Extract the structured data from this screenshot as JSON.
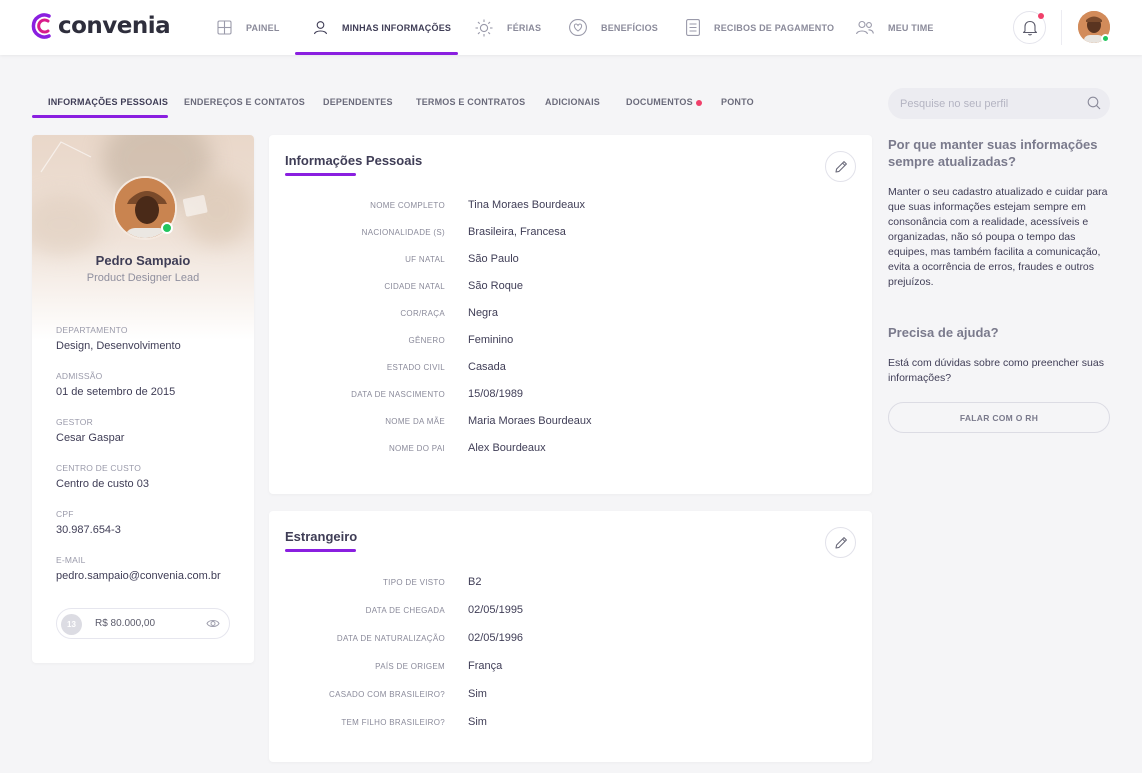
{
  "brand": {
    "name": "convenia",
    "accent": "#8a1fe0"
  },
  "nav": {
    "items": [
      {
        "label": "PAINEL",
        "icon": "grid-icon"
      },
      {
        "label": "MINHAS INFORMAÇÕES",
        "icon": "user-icon"
      },
      {
        "label": "FÉRIAS",
        "icon": "sun-icon"
      },
      {
        "label": "BENEFÍCIOS",
        "icon": "heart-icon"
      },
      {
        "label": "RECIBOS DE PAGAMENTO",
        "icon": "receipt-icon"
      },
      {
        "label": "MEU TIME",
        "icon": "team-icon"
      }
    ],
    "active": "MINHAS INFORMAÇÕES"
  },
  "subtabs": [
    {
      "label": "INFORMAÇÕES PESSOAIS"
    },
    {
      "label": "ENDEREÇOS E CONTATOS"
    },
    {
      "label": "DEPENDENTES"
    },
    {
      "label": "TERMOS E CONTRATOS"
    },
    {
      "label": "ADICIONAIS"
    },
    {
      "label": "DOCUMENTOS"
    },
    {
      "label": "PONTO"
    }
  ],
  "search": {
    "placeholder": "Pesquise no seu perfil"
  },
  "profile": {
    "name": "Pedro Sampaio",
    "role": "Product Designer Lead",
    "fields": [
      {
        "label": "DEPARTAMENTO",
        "value": "Design, Desenvolvimento"
      },
      {
        "label": "ADMISSÃO",
        "value": "01 de setembro de 2015"
      },
      {
        "label": "GESTOR",
        "value": "Cesar Gaspar"
      },
      {
        "label": "CENTRO DE CUSTO",
        "value": "Centro de custo 03"
      },
      {
        "label": "CPF",
        "value": "30.987.654-3"
      },
      {
        "label": "E-MAIL",
        "value": "pedro.sampaio@convenia.com.br"
      }
    ],
    "salary": {
      "coin": "13",
      "value": "R$ 80.000,00"
    }
  },
  "personal": {
    "title": "Informações Pessoais",
    "rows": [
      {
        "label": "NOME COMPLETO",
        "value": "Tina Moraes Bourdeaux"
      },
      {
        "label": "NACIONALIDADE (S)",
        "value": "Brasileira, Francesa"
      },
      {
        "label": "UF NATAL",
        "value": "São Paulo"
      },
      {
        "label": "CIDADE NATAL",
        "value": "São Roque"
      },
      {
        "label": "COR/RAÇA",
        "value": "Negra"
      },
      {
        "label": "GÊNERO",
        "value": "Feminino"
      },
      {
        "label": "ESTADO CIVIL",
        "value": "Casada"
      },
      {
        "label": "DATA DE NASCIMENTO",
        "value": "15/08/1989"
      },
      {
        "label": "NOME DA MÃE",
        "value": "Maria Moraes Bourdeaux"
      },
      {
        "label": "NOME DO PAI",
        "value": "Alex Bourdeaux"
      }
    ]
  },
  "foreign": {
    "title": "Estrangeiro",
    "rows": [
      {
        "label": "TIPO DE VISTO",
        "value": "B2"
      },
      {
        "label": "DATA DE CHEGADA",
        "value": "02/05/1995"
      },
      {
        "label": "DATA DE NATURALIZAÇÃO",
        "value": "02/05/1996"
      },
      {
        "label": "PAÍS DE ORIGEM",
        "value": "França"
      },
      {
        "label": "CASADO COM BRASILEIRO?",
        "value": "Sim"
      },
      {
        "label": "TEM FILHO BRASILEIRO?",
        "value": "Sim"
      }
    ]
  },
  "help": {
    "why_title": "Por que manter suas informações sempre atualizadas?",
    "why_text": "Manter o seu cadastro atualizado e cuidar para que suas informações estejam sempre em consonância com a realidade, acessíveis e organizadas, não só poupa o tempo das equipes, mas também facilita a comunicação, evita a ocorrência de erros, fraudes e outros prejuízos.",
    "need_title": "Precisa de ajuda?",
    "need_text": "Está com dúvidas sobre  como preencher suas informações?",
    "button": "FALAR COM O RH"
  },
  "notifications": {
    "icon": "bell-icon",
    "unread": true
  }
}
